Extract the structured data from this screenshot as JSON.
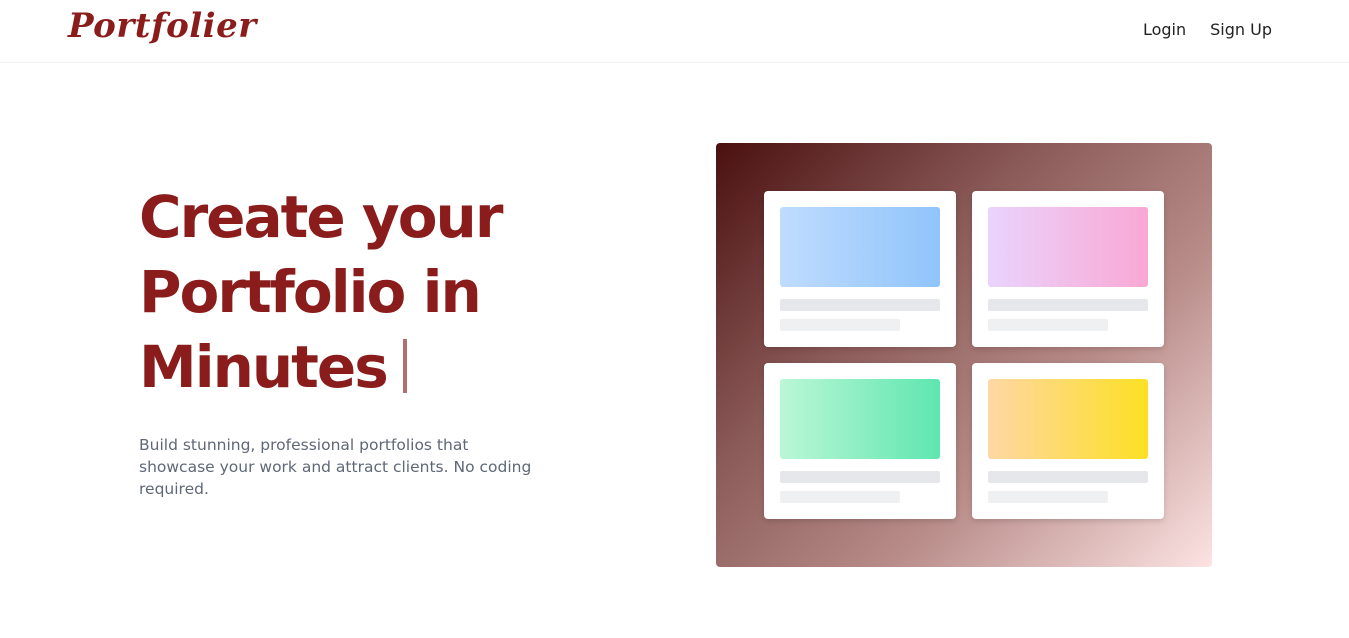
{
  "brand": {
    "name": "Portfolier",
    "color": "#8b1c1c"
  },
  "nav": {
    "login_label": "Login",
    "signup_label": "Sign Up"
  },
  "hero": {
    "title_line1": "Create your",
    "title_line2": "Portfolio in",
    "title_line3": "Minutes",
    "subtitle": "Build stunning, professional portfolios that showcase your work and attract clients. No coding required."
  },
  "preview": {
    "cards": [
      {
        "thumb_colors": [
          "#bfdcfe",
          "#90c4fb"
        ]
      },
      {
        "thumb_colors": [
          "#e9d4fd",
          "#f9a8d4"
        ]
      },
      {
        "thumb_colors": [
          "#bbf7d6",
          "#5fe6b0"
        ]
      },
      {
        "thumb_colors": [
          "#fed7a4",
          "#fde024"
        ]
      }
    ],
    "gradient": [
      "#4a1010",
      "#fce3e3"
    ]
  }
}
